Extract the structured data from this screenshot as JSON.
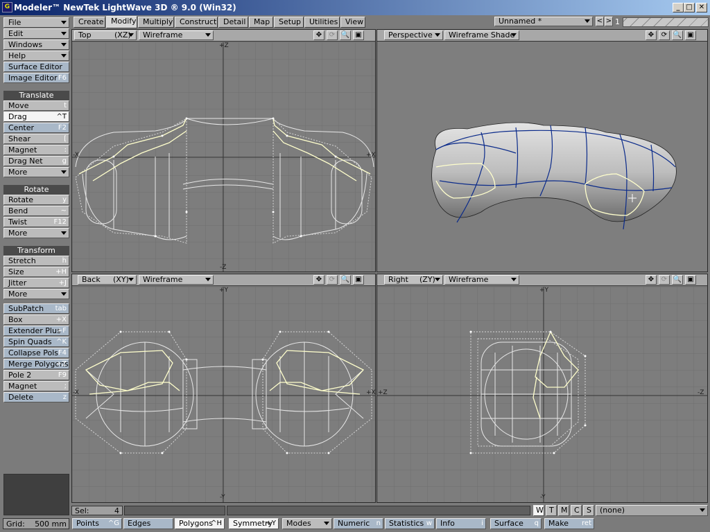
{
  "window": {
    "title": "Modeler™ NewTek LightWave 3D ® 9.0 (Win32)",
    "icon_letter": "G",
    "minimize": "_",
    "maximize": "□",
    "close": "✕"
  },
  "tabs": [
    {
      "label": "Create"
    },
    {
      "label": "Modify"
    },
    {
      "label": "Multiply"
    },
    {
      "label": "Construct"
    },
    {
      "label": "Detail"
    },
    {
      "label": "Map"
    },
    {
      "label": "Setup"
    },
    {
      "label": "Utilities"
    },
    {
      "label": "View"
    }
  ],
  "active_tab": "Modify",
  "object_selector": {
    "value": "Unnamed *",
    "layer_num": "1",
    "prev": "<",
    "next": ">"
  },
  "menus": [
    {
      "label": "File"
    },
    {
      "label": "Edit"
    },
    {
      "label": "Windows"
    },
    {
      "label": "Help"
    }
  ],
  "editors": [
    {
      "label": "Surface Editor",
      "shortcut": ""
    },
    {
      "label": "Image Editor",
      "shortcut": "F6"
    }
  ],
  "translate": {
    "header": "Translate",
    "items": [
      {
        "label": "Move",
        "shortcut": "t"
      },
      {
        "label": "Drag",
        "shortcut": "^T"
      },
      {
        "label": "Center",
        "shortcut": "F2"
      },
      {
        "label": "Shear",
        "shortcut": "["
      },
      {
        "label": "Magnet",
        "shortcut": ":"
      },
      {
        "label": "Drag Net",
        "shortcut": "g"
      },
      {
        "label": "More",
        "shortcut": ""
      }
    ]
  },
  "rotate": {
    "header": "Rotate",
    "items": [
      {
        "label": "Rotate",
        "shortcut": "y"
      },
      {
        "label": "Bend",
        "shortcut": "~"
      },
      {
        "label": "Twist",
        "shortcut": "F12"
      },
      {
        "label": "More",
        "shortcut": ""
      }
    ]
  },
  "transform": {
    "header": "Transform",
    "items": [
      {
        "label": "Stretch",
        "shortcut": "h"
      },
      {
        "label": "Size",
        "shortcut": "+H"
      },
      {
        "label": "Jitter",
        "shortcut": "+J"
      },
      {
        "label": "More",
        "shortcut": ""
      }
    ]
  },
  "tools": [
    {
      "label": "SubPatch",
      "shortcut": "tab"
    },
    {
      "label": "Box",
      "shortcut": "+X"
    },
    {
      "label": "Extender Plus",
      "shortcut": "+F"
    },
    {
      "label": "Spin Quads",
      "shortcut": "^K"
    },
    {
      "label": "Collapse Pols",
      "shortcut": "F4"
    },
    {
      "label": "Merge Polygons",
      "shortcut": "+Z"
    },
    {
      "label": "Pole 2",
      "shortcut": "F9"
    },
    {
      "label": "Magnet",
      "shortcut": ";"
    },
    {
      "label": "Delete",
      "shortcut": "z"
    }
  ],
  "viewports": {
    "top": {
      "view": "Top",
      "axes": "(XZ)",
      "mode": "Wireframe",
      "axis_top": "+Z",
      "axis_bottom": "-Z",
      "axis_left": "-X",
      "axis_right": "+X"
    },
    "perspective": {
      "view": "Perspective",
      "mode": "Wireframe Shade"
    },
    "back": {
      "view": "Back",
      "axes": "(XY)",
      "mode": "Wireframe",
      "axis_top": "+Y",
      "axis_bottom": "-Y",
      "axis_left": "-X",
      "axis_right": "+X"
    },
    "right": {
      "view": "Right",
      "axes": "(ZY)",
      "mode": "Wireframe",
      "axis_top": "+Y",
      "axis_bottom": "-Y",
      "axis_left": "+Z",
      "axis_right": "-Z"
    }
  },
  "status": {
    "sel_label": "Sel:",
    "sel_value": "4",
    "wtmcs": [
      "W",
      "T",
      "M",
      "C",
      "S"
    ],
    "none_select": "(none)"
  },
  "bottom": {
    "grid_label": "Grid:",
    "grid_value": "500 mm",
    "points": {
      "label": "Points",
      "shortcut": "^G"
    },
    "edges": {
      "label": "Edges",
      "shortcut": ""
    },
    "polygons": {
      "label": "Polygons",
      "shortcut": "^H"
    },
    "symmetry": {
      "label": "Symmetry",
      "shortcut": "+Y"
    },
    "modes": {
      "label": "Modes"
    },
    "numeric": {
      "label": "Numeric",
      "shortcut": "n"
    },
    "statistics": {
      "label": "Statistics",
      "shortcut": "w"
    },
    "info": {
      "label": "Info",
      "shortcut": "i"
    },
    "surface": {
      "label": "Surface",
      "shortcut": "q"
    },
    "make": {
      "label": "Make",
      "shortcut": "ret"
    }
  },
  "colors": {
    "titlebar_start": "#0a246a",
    "titlebar_end": "#a6caf0",
    "viewport_bg": "#7d7d7d",
    "selection_yellow": "#ffffcc",
    "mesh_white": "#e8e8e8",
    "perspective_edge_blue": "#0a2a8a"
  }
}
